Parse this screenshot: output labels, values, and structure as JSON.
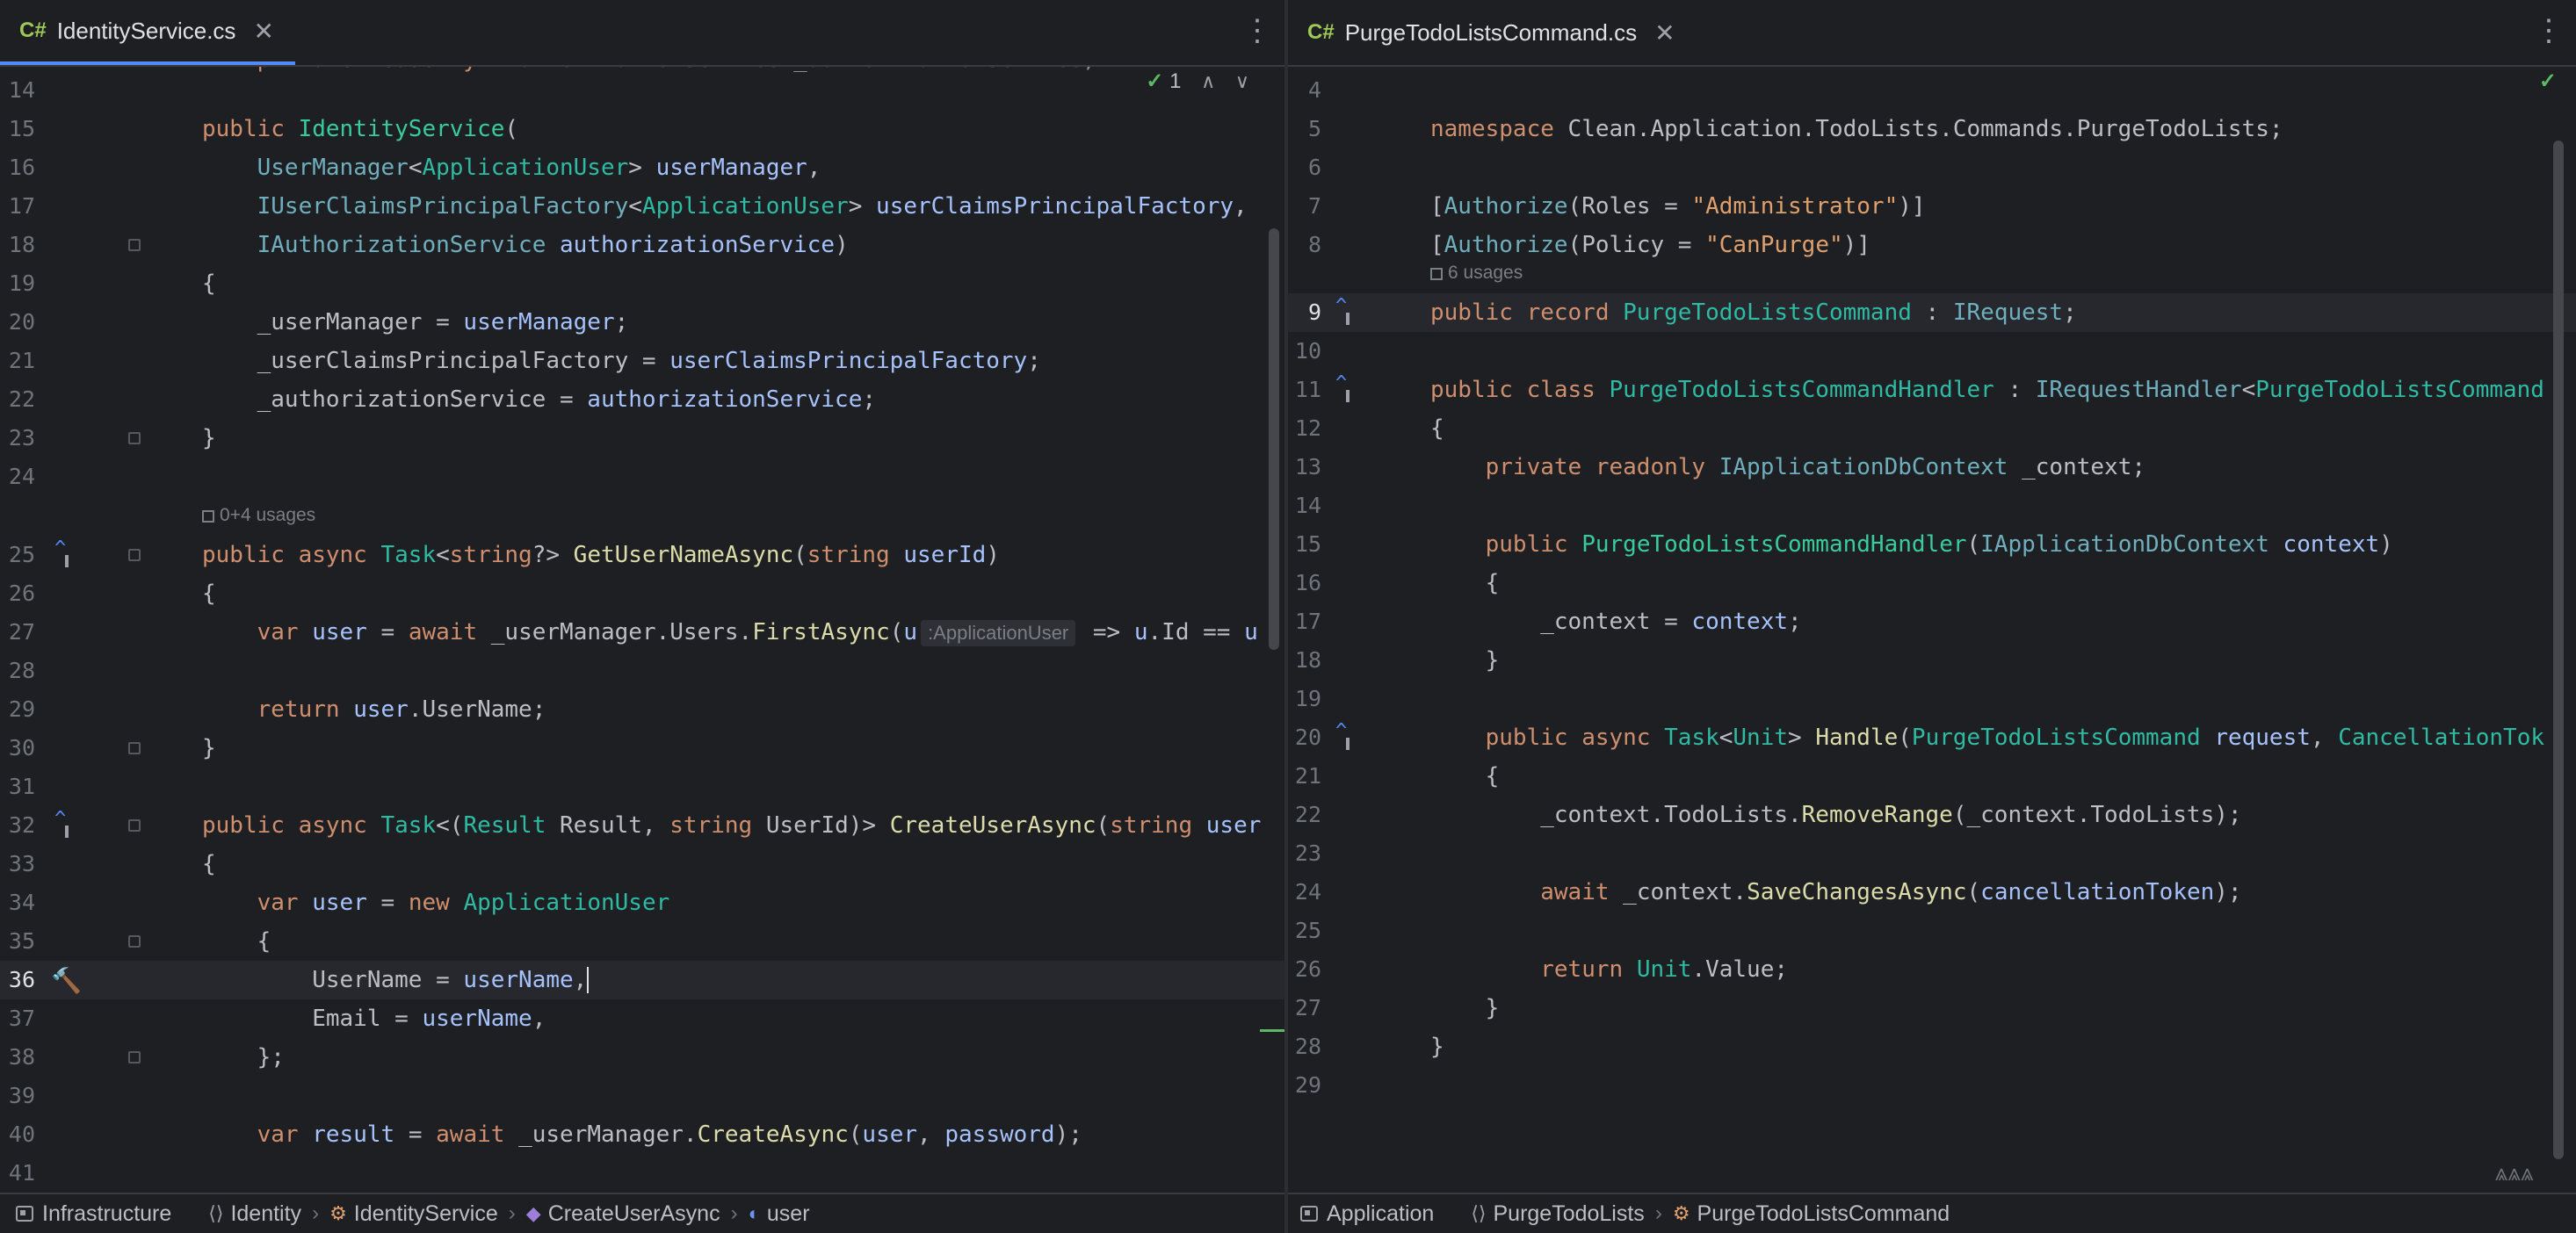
{
  "left": {
    "tab": {
      "badge": "C#",
      "filename": "IdentityService.cs",
      "close": "✕"
    },
    "inspection": {
      "check": "✓",
      "count": "1",
      "up": "∧",
      "down": "∨"
    },
    "usages_hint": "0+4 usages",
    "param_hint": ":ApplicationUser",
    "line_numbers": [
      "14",
      "15",
      "16",
      "17",
      "18",
      "19",
      "20",
      "21",
      "22",
      "23",
      "24",
      "25",
      "26",
      "27",
      "28",
      "29",
      "30",
      "31",
      "32",
      "33",
      "34",
      "35",
      "36",
      "37",
      "38",
      "39",
      "40",
      "41"
    ],
    "breadcrumbs": {
      "module": "Infrastructure",
      "namespace": "Identity",
      "class": "IdentityService",
      "method": "CreateUserAsync",
      "variable": "user"
    }
  },
  "right": {
    "tab": {
      "badge": "C#",
      "filename": "PurgeTodoListsCommand.cs",
      "close": "✕"
    },
    "inspection": {
      "check": "✓"
    },
    "usages_hint": "6 usages",
    "line_numbers": [
      "4",
      "5",
      "6",
      "7",
      "8",
      "9",
      "10",
      "11",
      "12",
      "13",
      "14",
      "15",
      "16",
      "17",
      "18",
      "19",
      "20",
      "21",
      "22",
      "23",
      "24",
      "25",
      "26",
      "27",
      "28",
      "29"
    ],
    "breadcrumbs": {
      "module": "Application",
      "namespace": "PurgeTodoLists",
      "class": "PurgeTodoListsCommand"
    }
  },
  "icons": {
    "kebab": "⋮",
    "hammer": "🔨",
    "sep": "›"
  }
}
